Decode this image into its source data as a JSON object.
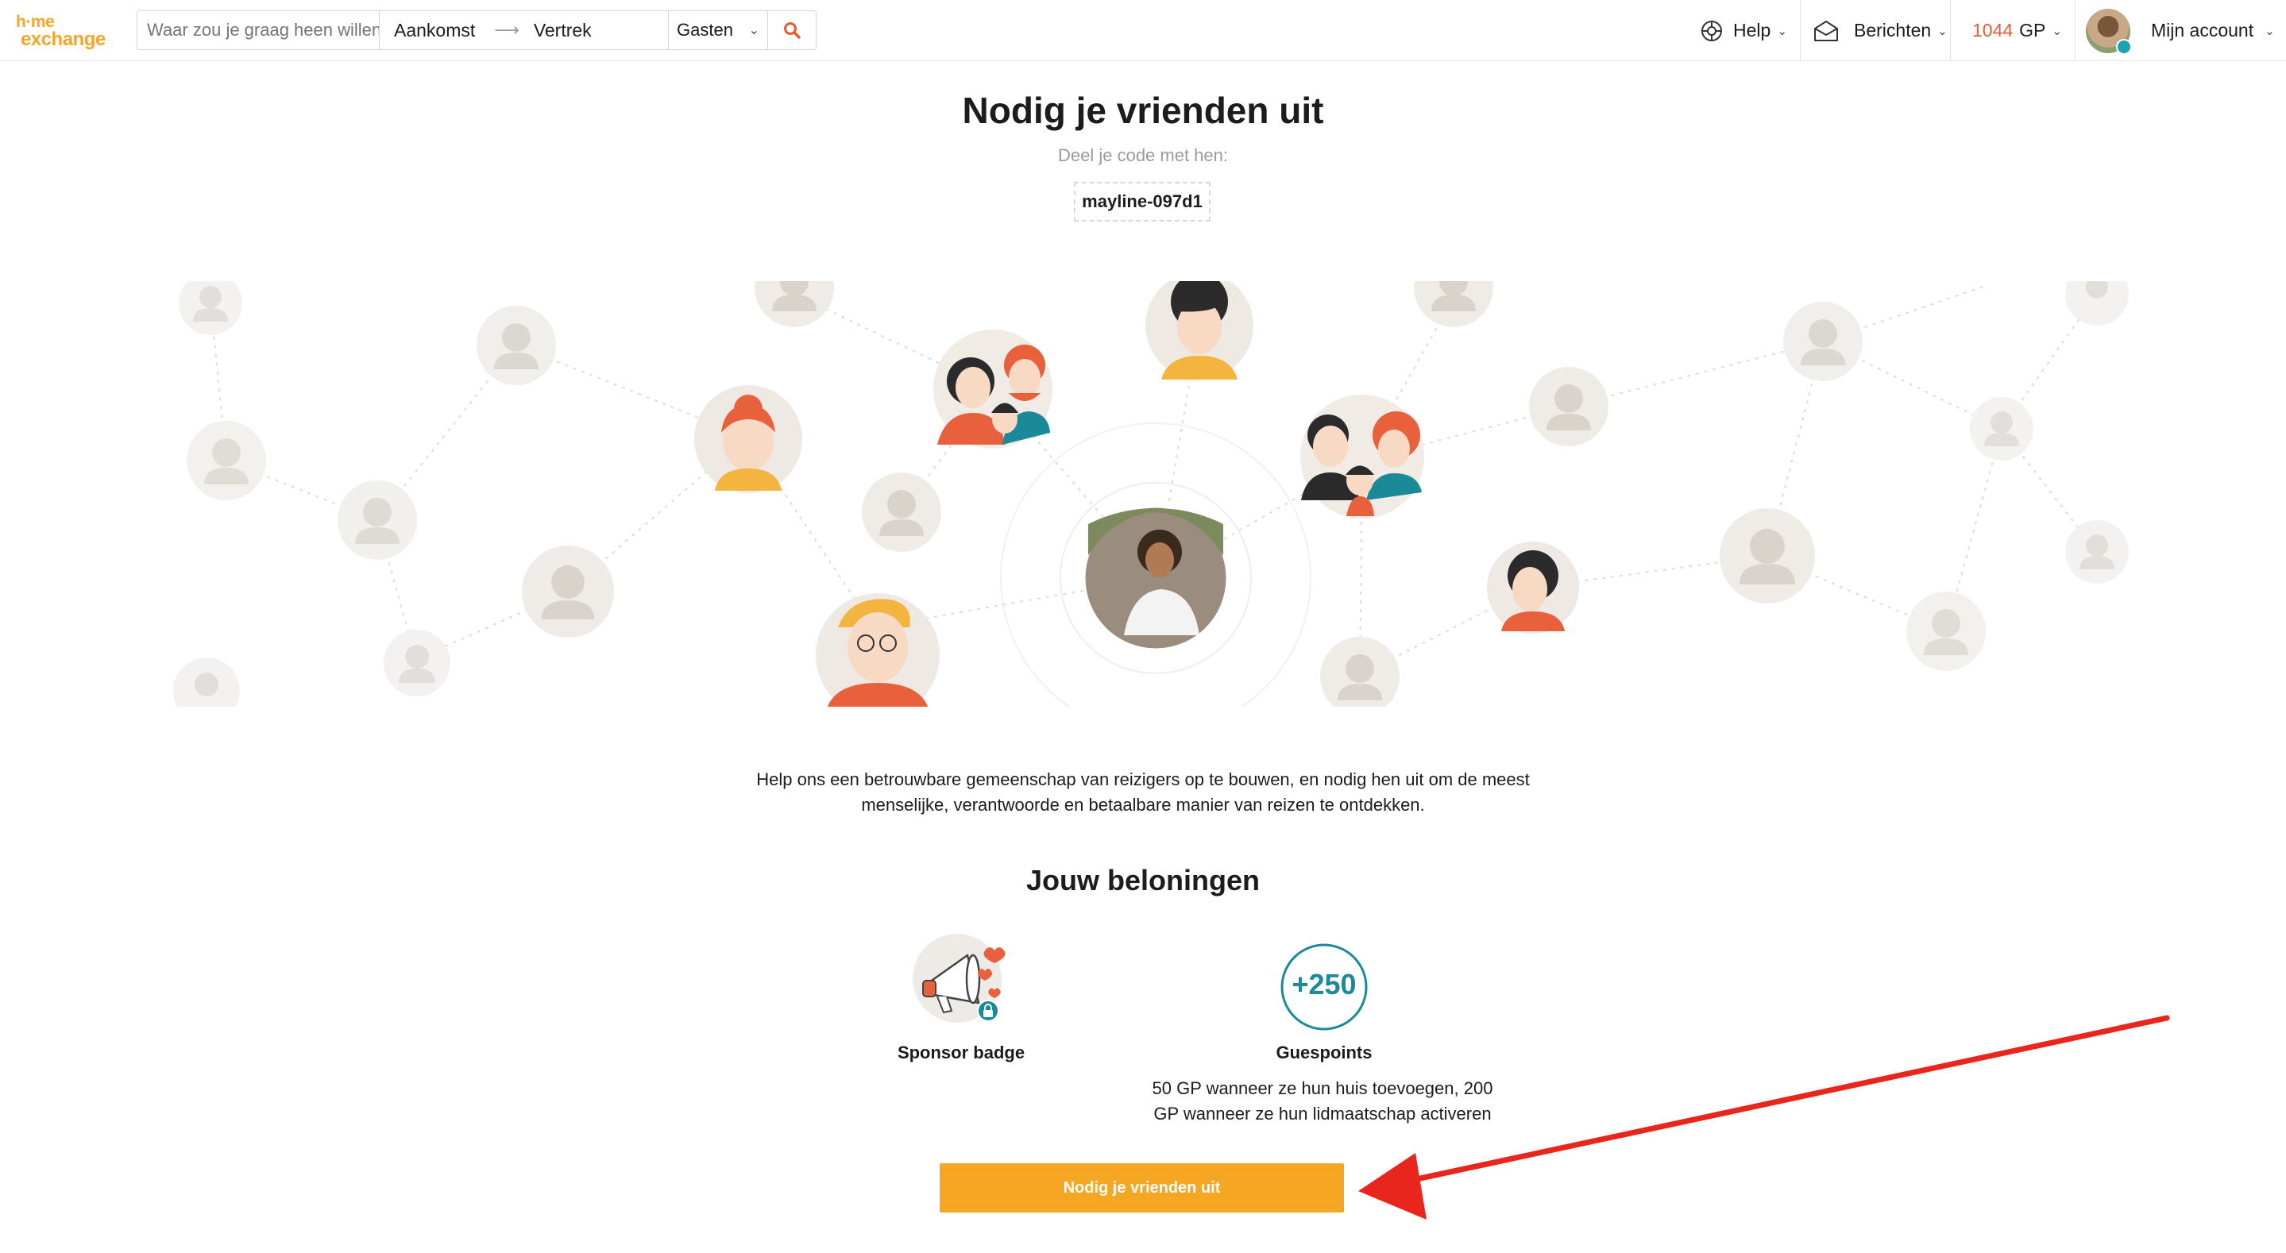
{
  "header": {
    "logo_line1": "h·me",
    "logo_line2": "exchange",
    "search_placeholder": "Waar zou je graag heen willen?",
    "arrival": "Aankomst",
    "departure": "Vertrek",
    "guests": "Gasten",
    "help": "Help",
    "messages": "Berichten",
    "gp_amount": "1044",
    "gp_unit": "GP",
    "account": "Mijn account"
  },
  "main": {
    "title": "Nodig je vrienden uit",
    "share_label": "Deel je code met hen:",
    "code": "mayline-097d1",
    "intro_line1": "Help ons een betrouwbare gemeenschap van reizigers op te bouwen, en nodig hen uit om de meest",
    "intro_line2": "menselijke, verantwoorde en betaalbare manier van reizen te ontdekken.",
    "rewards_title": "Jouw beloningen",
    "badge_label": "Sponsor badge",
    "points_value": "+250",
    "points_label": "Guespoints",
    "points_desc_line1": "50 GP wanneer ze hun huis toevoegen, 200",
    "points_desc_line2": "GP wanneer ze hun lidmaatschap activeren",
    "cta_label": "Nodig je vrienden uit"
  },
  "colors": {
    "brand": "#f5a623",
    "accent": "#ea5b31",
    "teal": "#1a8a99",
    "annotation_arrow": "#e8261d"
  },
  "icons": [
    "help-lifebuoy-icon",
    "messages-envelope-icon",
    "search-icon",
    "chevron-down-icon",
    "megaphone-icon",
    "lock-icon",
    "user-placeholder-icon"
  ]
}
